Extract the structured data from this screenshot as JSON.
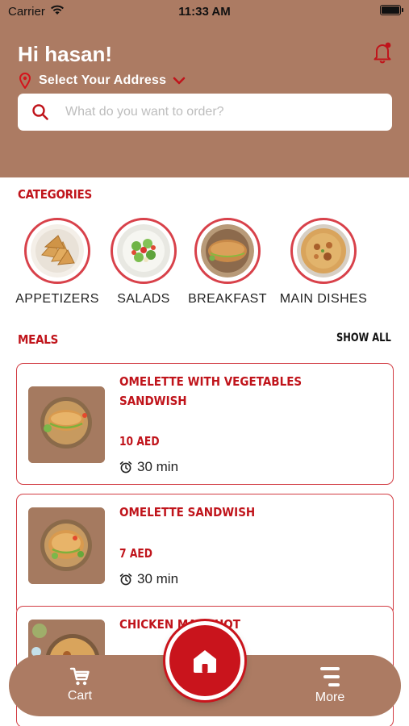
{
  "status_bar": {
    "carrier": "Carrier",
    "time": "11:33 AM"
  },
  "header": {
    "greeting": "Hi hasan!",
    "address_label": "Select Your Address",
    "background_color": "#ac7b63"
  },
  "search": {
    "placeholder": "What do you want to order?"
  },
  "categories": {
    "title": "CATEGORIES",
    "items": [
      {
        "label": "APPETIZERS",
        "image": "samosa-plate"
      },
      {
        "label": "SALADS",
        "image": "salad-bowl"
      },
      {
        "label": "BREAKFAST",
        "image": "sandwich-plate"
      },
      {
        "label": "MAIN DISHES",
        "image": "rice-platter"
      }
    ]
  },
  "meals": {
    "title": "MEALS",
    "show_all": "SHOW ALL",
    "items": [
      {
        "name": "OMELETTE WITH VEGETABLES SANDWISH",
        "price": "10 AED",
        "time": "30 min"
      },
      {
        "name": "OMELETTE SANDWISH",
        "price": "7 AED",
        "time": "30 min"
      },
      {
        "name": "CHICKEN MADGHOT",
        "price": "",
        "time": ""
      }
    ]
  },
  "nav": {
    "cart_label": "Cart",
    "more_label": "More"
  },
  "colors": {
    "accent": "#c0141b",
    "brand_brown": "#ac7b63",
    "border_red": "#d23c43"
  }
}
